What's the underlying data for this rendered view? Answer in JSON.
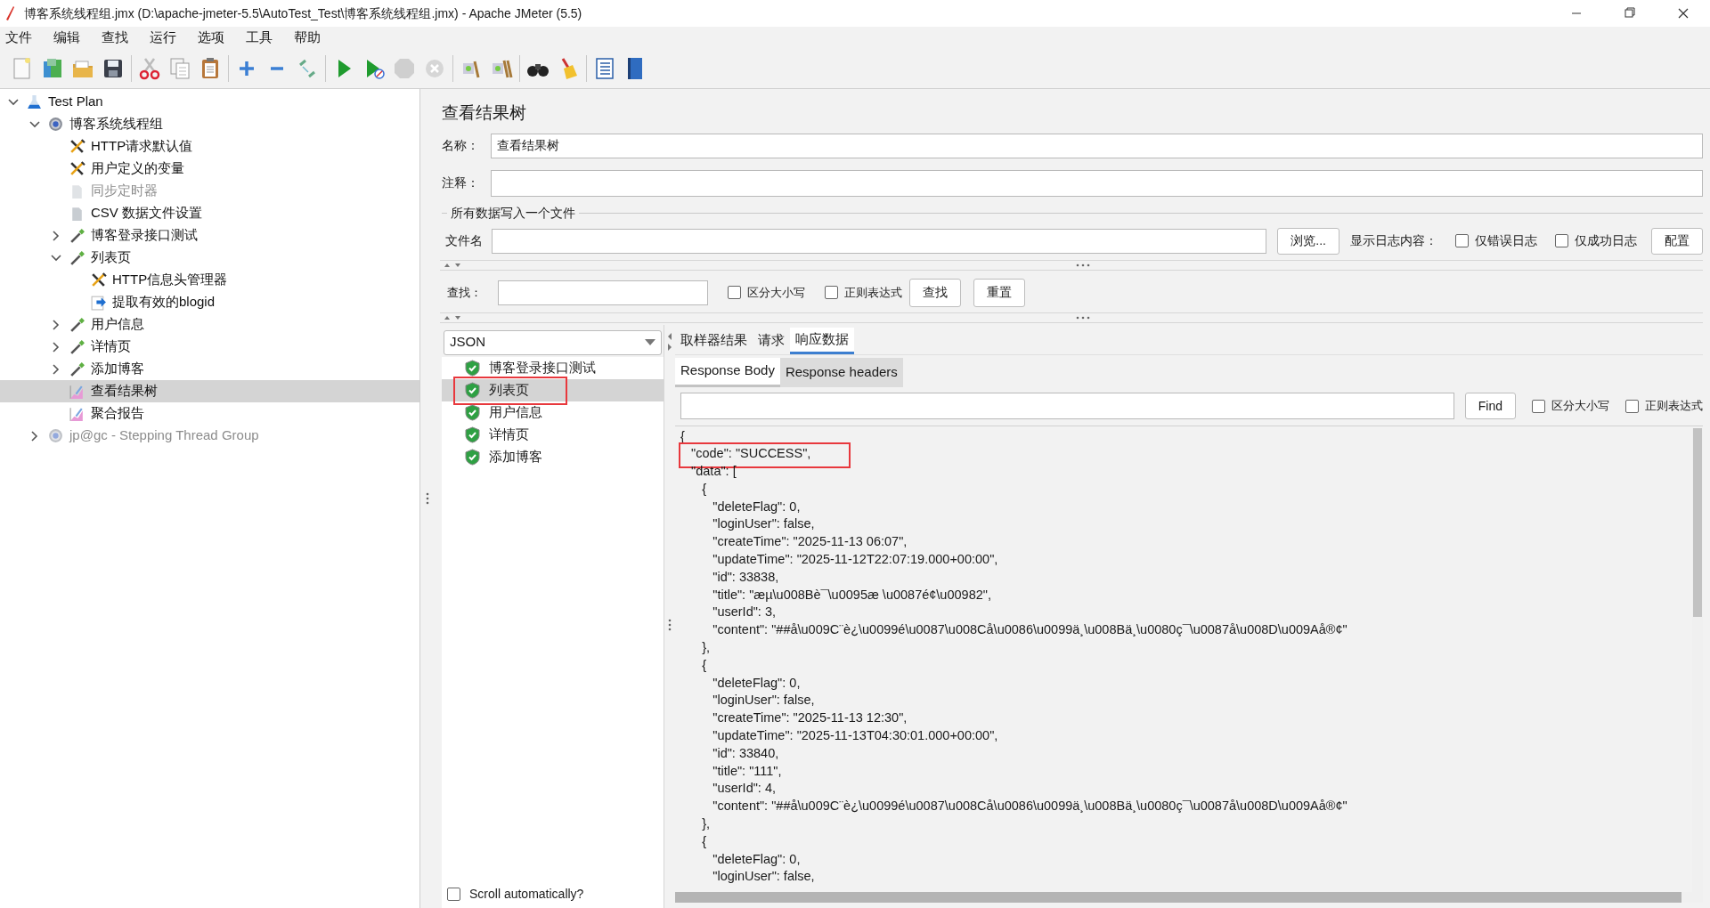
{
  "window": {
    "title": "博客系统线程组.jmx (D:\\apache-jmeter-5.5\\AutoTest_Test\\博客系统线程组.jmx) - Apache JMeter (5.5)"
  },
  "menu": [
    "文件",
    "编辑",
    "查找",
    "运行",
    "选项",
    "工具",
    "帮助"
  ],
  "tree": [
    {
      "label": "Test Plan",
      "kind": "plan",
      "expanded": true,
      "selected": false,
      "disabled": false,
      "children": [
        {
          "label": "博客系统线程组",
          "kind": "thread_group",
          "expanded": true,
          "selected": false,
          "disabled": false,
          "children": [
            {
              "label": "HTTP请求默认值",
              "kind": "config",
              "selected": false,
              "disabled": false
            },
            {
              "label": "用户定义的变量",
              "kind": "config",
              "selected": false,
              "disabled": false
            },
            {
              "label": "同步定时器",
              "kind": "page",
              "selected": false,
              "disabled": true
            },
            {
              "label": "CSV 数据文件设置",
              "kind": "page",
              "selected": false,
              "disabled": false
            },
            {
              "label": "博客登录接口测试",
              "kind": "sampler",
              "expanded": false,
              "selected": false,
              "disabled": false
            },
            {
              "label": "列表页",
              "kind": "sampler",
              "expanded": true,
              "selected": false,
              "disabled": false,
              "children": [
                {
                  "label": "HTTP信息头管理器",
                  "kind": "config",
                  "selected": false,
                  "disabled": false
                },
                {
                  "label": "提取有效的blogid",
                  "kind": "extractor",
                  "selected": false,
                  "disabled": false
                }
              ]
            },
            {
              "label": "用户信息",
              "kind": "sampler",
              "expanded": false,
              "selected": false,
              "disabled": false
            },
            {
              "label": "详情页",
              "kind": "sampler",
              "expanded": false,
              "selected": false,
              "disabled": false
            },
            {
              "label": "添加博客",
              "kind": "sampler",
              "expanded": false,
              "selected": false,
              "disabled": false
            },
            {
              "label": "查看结果树",
              "kind": "listener",
              "selected": true,
              "disabled": false
            },
            {
              "label": "聚合报告",
              "kind": "listener",
              "selected": false,
              "disabled": false
            }
          ]
        },
        {
          "label": "jp@gc - Stepping Thread Group",
          "kind": "thread_group",
          "expanded": false,
          "selected": false,
          "disabled": true
        }
      ]
    }
  ],
  "panel": {
    "title": "查看结果树",
    "name": {
      "label": "名称：",
      "value": "查看结果树"
    },
    "comment": {
      "label": "注释："
    },
    "file_section": {
      "title": "所有数据写入一个文件",
      "file_label": "文件名",
      "browse": "浏览...",
      "log_label": "显示日志内容：",
      "checkboxes": [
        {
          "label": "仅错误日志",
          "checked": false
        },
        {
          "label": "仅成功日志",
          "checked": false
        }
      ],
      "config": "配置"
    },
    "search": {
      "label": "查找：",
      "checkboxes": [
        {
          "label": "区分大小写",
          "checked": false
        },
        {
          "label": "正则表达式",
          "checked": false
        }
      ],
      "find": "查找",
      "reset": "重置"
    }
  },
  "results": {
    "renderer": "JSON",
    "items": [
      {
        "label": "博客登录接口测试",
        "kind": "success",
        "selected": false,
        "highlighted": false
      },
      {
        "label": "列表页",
        "kind": "success",
        "selected": true,
        "highlighted": true
      },
      {
        "label": "用户信息",
        "kind": "success",
        "selected": false,
        "highlighted": false
      },
      {
        "label": "详情页",
        "kind": "success",
        "selected": false,
        "highlighted": false
      },
      {
        "label": "添加博客",
        "kind": "success",
        "selected": false,
        "highlighted": false
      }
    ],
    "scroll_auto": {
      "label": "Scroll automatically?",
      "checked": false
    }
  },
  "tabs": [
    {
      "label": "取样器结果",
      "selected": false
    },
    {
      "label": "请求",
      "selected": false
    },
    {
      "label": "响应数据",
      "selected": true
    }
  ],
  "subtabs": [
    {
      "label": "Response Body",
      "selected": true
    },
    {
      "label": "Response headers",
      "selected": false
    }
  ],
  "find": {
    "button": "Find",
    "checkboxes": [
      {
        "label": "区分大小写",
        "checked": false
      },
      {
        "label": "正则表达式",
        "checked": false
      }
    ]
  },
  "body_lines": [
    {
      "text": "{",
      "highlighted": false
    },
    {
      "text": "   \"code\": \"SUCCESS\",",
      "highlighted": true
    },
    {
      "text": "   \"data\": [",
      "highlighted": false
    },
    {
      "text": "      {",
      "highlighted": false
    },
    {
      "text": "         \"deleteFlag\": 0,",
      "highlighted": false
    },
    {
      "text": "         \"loginUser\": false,",
      "highlighted": false
    },
    {
      "text": "         \"createTime\": \"2025-11-13 06:07\",",
      "highlighted": false
    },
    {
      "text": "         \"updateTime\": \"2025-11-12T22:07:19.000+00:00\",",
      "highlighted": false
    },
    {
      "text": "         \"id\": 33838,",
      "highlighted": false
    },
    {
      "text": "         \"title\": \"æµ\\u008Bè¯\\u0095æ \\u0087é¢\\u00982\",",
      "highlighted": false
    },
    {
      "text": "         \"userId\": 3,",
      "highlighted": false
    },
    {
      "text": "         \"content\": \"##å\\u009C¨è¿\\u0099é\\u0087\\u008Cå\\u0086\\u0099ä¸\\u008Bä¸\\u0080ç¯\\u0087å\\u008D\\u009Aå®¢\"",
      "highlighted": false
    },
    {
      "text": "      },",
      "highlighted": false
    },
    {
      "text": "      {",
      "highlighted": false
    },
    {
      "text": "         \"deleteFlag\": 0,",
      "highlighted": false
    },
    {
      "text": "         \"loginUser\": false,",
      "highlighted": false
    },
    {
      "text": "         \"createTime\": \"2025-11-13 12:30\",",
      "highlighted": false
    },
    {
      "text": "         \"updateTime\": \"2025-11-13T04:30:01.000+00:00\",",
      "highlighted": false
    },
    {
      "text": "         \"id\": 33840,",
      "highlighted": false
    },
    {
      "text": "         \"title\": \"111\",",
      "highlighted": false
    },
    {
      "text": "         \"userId\": 4,",
      "highlighted": false
    },
    {
      "text": "         \"content\": \"##å\\u009C¨è¿\\u0099é\\u0087\\u008Cå\\u0086\\u0099ä¸\\u008Bä¸\\u0080ç¯\\u0087å\\u008D\\u009Aå®¢\"",
      "highlighted": false
    },
    {
      "text": "      },",
      "highlighted": false
    },
    {
      "text": "      {",
      "highlighted": false
    },
    {
      "text": "         \"deleteFlag\": 0,",
      "highlighted": false
    },
    {
      "text": "         \"loginUser\": false,",
      "highlighted": false
    }
  ]
}
